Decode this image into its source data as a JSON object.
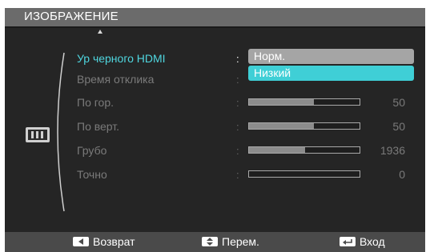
{
  "menu": {
    "title": "ИЗОБРАЖЕНИЕ"
  },
  "rows": [
    {
      "label": "Ур черного HDMI",
      "active": true
    },
    {
      "label": "Время отклика"
    },
    {
      "label": "По гор.",
      "value": "50",
      "level": 0.59
    },
    {
      "label": "По верт.",
      "value": "50",
      "level": 0.59
    },
    {
      "label": "Грубо",
      "value": "1936",
      "level": 0.51
    },
    {
      "label": "Точно",
      "value": "0",
      "level": 0.0
    }
  ],
  "colon": ":",
  "dropdown": {
    "options": [
      "Норм.",
      "Низкий"
    ],
    "highlighted": "Низкий"
  },
  "footer": {
    "back_label": "Возврат",
    "back_icon": "left-arrow-key-icon",
    "move_label": "Перем.",
    "move_icon": "up-down-key-icon",
    "enter_label": "Вход",
    "enter_icon": "enter-key-icon"
  },
  "category_icon": "picture-icon",
  "colors": {
    "accent": "#4fd6df",
    "highlight": "#3fcfd6",
    "background": "#252525"
  }
}
